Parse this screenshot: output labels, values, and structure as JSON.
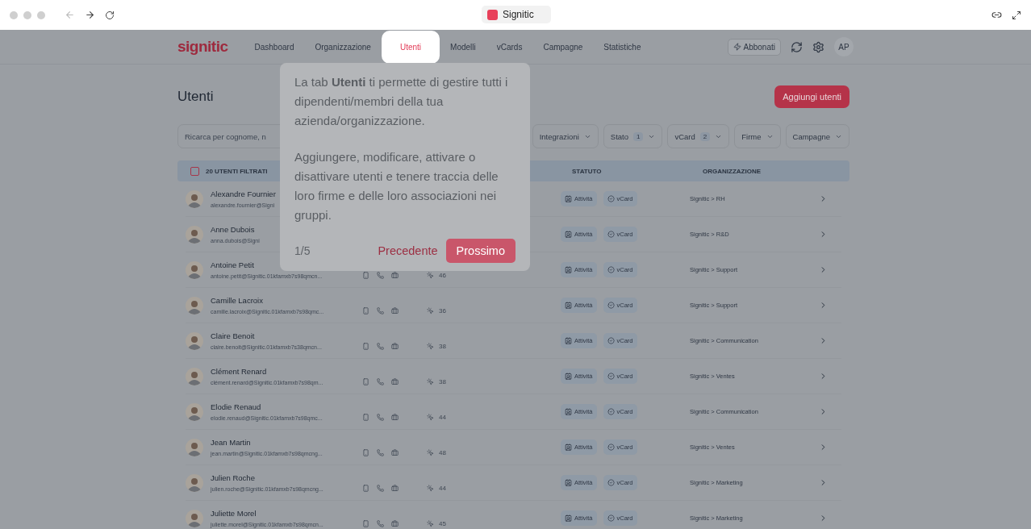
{
  "browser": {
    "tab_title": "Signitic"
  },
  "app": {
    "logo": "signitic",
    "nav": [
      {
        "label": "Dashboard",
        "selected": false
      },
      {
        "label": "Organizzazione",
        "selected": false
      },
      {
        "label": "Utenti",
        "selected": true
      },
      {
        "label": "Modelli",
        "selected": false
      },
      {
        "label": "vCards",
        "selected": false
      },
      {
        "label": "Campagne",
        "selected": false
      },
      {
        "label": "Statistiche",
        "selected": false
      }
    ],
    "subscribe_button": "Abbonati",
    "avatar": "AP"
  },
  "page": {
    "title": "Utenti",
    "add_button": "Aggiungi utenti",
    "search": {
      "placeholder": "Ricarca per cognome, n"
    },
    "filters": [
      {
        "label": "Integrazioni"
      },
      {
        "label": "Stato",
        "count": "1"
      },
      {
        "label": "vCard",
        "count": "2"
      },
      {
        "label": "Firme"
      },
      {
        "label": "Campagne"
      }
    ]
  },
  "table": {
    "select_all": {
      "checked": false,
      "label": "20 UTENTI FILTRATI"
    },
    "columns": [
      "STATUTO",
      "ORGANIZZAZIONE"
    ],
    "rows": [
      {
        "name": "Alexandre Fournier",
        "email": "alexandre.fournier@Signi",
        "status": [
          {
            "kind": "activity",
            "label": "Attività"
          },
          {
            "kind": "vcard",
            "label": "vCard"
          }
        ],
        "org": "Signitic > RH"
      },
      {
        "name": "Anne Dubois",
        "email": "anna.dubois@Signi",
        "status": [
          {
            "kind": "activity",
            "label": "Attività"
          },
          {
            "kind": "vcard",
            "label": "vCard"
          }
        ],
        "org": "Signitic > R&D"
      },
      {
        "name": "Antoine Petit",
        "email": "antoine.petit@Signitic.01kfamxb7s98qmcn...",
        "count": "46",
        "status": [
          {
            "kind": "activity",
            "label": "Attività"
          },
          {
            "kind": "vcard",
            "label": "vCard"
          }
        ],
        "org": "Signitic > Support"
      },
      {
        "name": "Camille Lacroix",
        "email": "camille.lacroix@Signitic.01kfamxb7s98qmc...",
        "count": "36",
        "status": [
          {
            "kind": "activity",
            "label": "Attività"
          },
          {
            "kind": "vcard",
            "label": "vCard"
          }
        ],
        "org": "Signitic > Support"
      },
      {
        "name": "Claire Benoit",
        "email": "claire.benoit@Signitic.01kfamxb7s38qmcn...",
        "count": "38",
        "status": [
          {
            "kind": "activity",
            "label": "Attività"
          },
          {
            "kind": "vcard",
            "label": "vCard"
          }
        ],
        "org": "Signitic > Communication"
      },
      {
        "name": "Clément Renard",
        "email": "clément.renard@Signitic.01kfamxb7s98qm...",
        "count": "38",
        "status": [
          {
            "kind": "activity",
            "label": "Attività"
          },
          {
            "kind": "vcard",
            "label": "vCard"
          }
        ],
        "org": "Signitic > Ventes"
      },
      {
        "name": "Elodie Renaud",
        "email": "elodie.renaud@Signitic.01kfamxb7s98qmc...",
        "count": "44",
        "status": [
          {
            "kind": "activity",
            "label": "Attività"
          },
          {
            "kind": "vcard",
            "label": "vCard"
          }
        ],
        "org": "Signitic > Communication"
      },
      {
        "name": "Jean Martin",
        "email": "jean.martin@Signitic.01kfamxb7s98qmcng...",
        "count": "48",
        "status": [
          {
            "kind": "activity",
            "label": "Attività"
          },
          {
            "kind": "vcard",
            "label": "vCard"
          }
        ],
        "org": "Signitic > Ventes"
      },
      {
        "name": "Julien Roche",
        "email": "julien.roche@Signitic.01kfamxb7s98qmcng...",
        "count": "44",
        "status": [
          {
            "kind": "activity",
            "label": "Attività"
          },
          {
            "kind": "vcard",
            "label": "vCard"
          }
        ],
        "org": "Signitic > Marketing"
      },
      {
        "name": "Juliette Morel",
        "email": "juliette.morel@Signitic.01kfamxb7s98qmcn...",
        "count": "45",
        "status": [
          {
            "kind": "activity",
            "label": "Attività"
          },
          {
            "kind": "vcard",
            "label": "vCard"
          }
        ],
        "org": "Signitic > Marketing"
      }
    ]
  },
  "tour": {
    "paragraphs": [
      "La tab **Utenti** ti permette di gestire tutti i dipendenti/membri della tua azienda/organizzazione.",
      "Aggiungere, modificare, attivare o disattivare utenti e tenere traccia delle loro firme e delle loro associazioni nei gruppi."
    ],
    "step": "1/5",
    "prev_button": "Precedente",
    "next_button": "Prossimo"
  }
}
